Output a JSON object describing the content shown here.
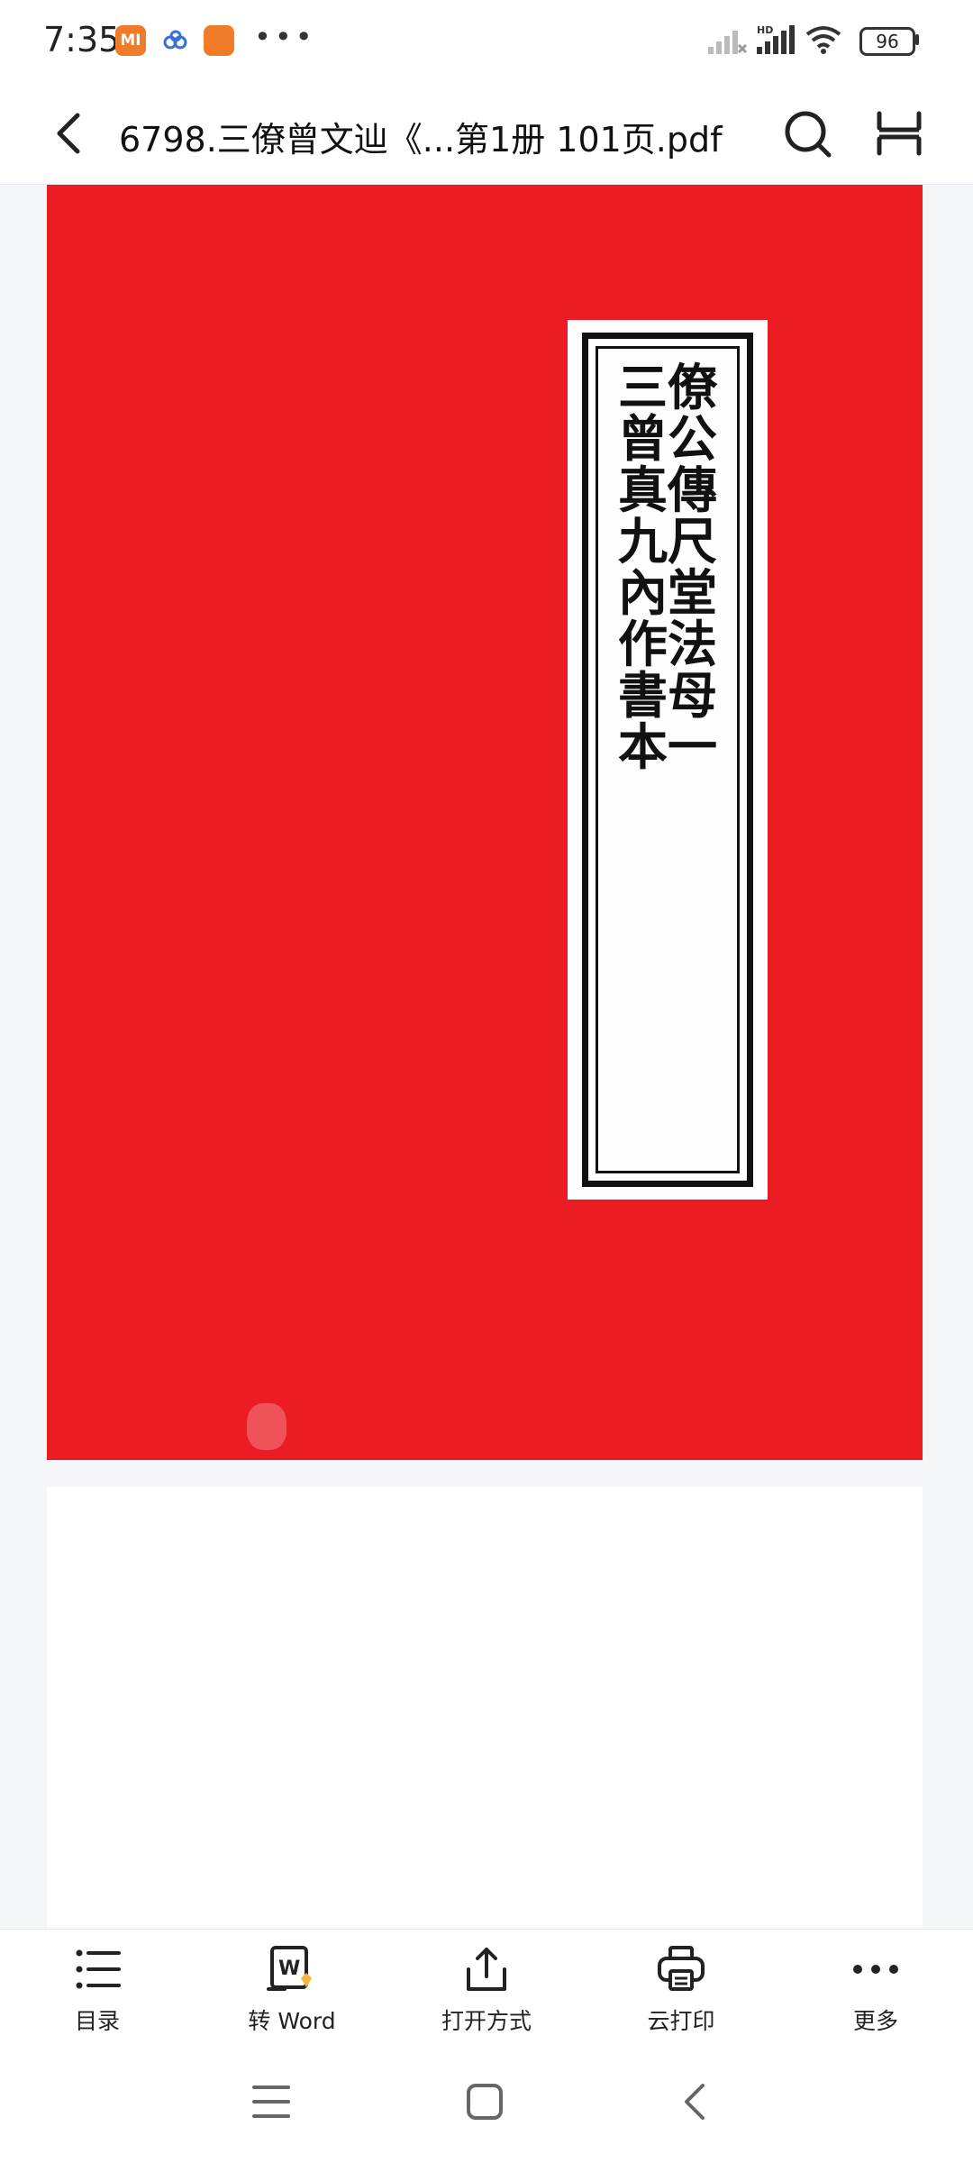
{
  "status_bar": {
    "time": "7:35",
    "mi_label": "MI",
    "battery": "96",
    "icons": [
      "mi-app-icon",
      "cloud-app-icon",
      "shopping-app-icon",
      "more-notifications-icon",
      "signal-icon",
      "hd-signal-icon",
      "wifi-icon",
      "battery-icon"
    ]
  },
  "header": {
    "title": "6798.三僚曾文辿《...第1册 101页.pdf",
    "icons": [
      "back-arrow-icon",
      "search-icon",
      "layout-icon"
    ]
  },
  "document": {
    "cover_title": "三僚曾公真傳九尺內堂作法書母本一",
    "cover_color": "#ec1c24"
  },
  "toolbar": {
    "items": [
      {
        "label": "目录",
        "icon": "list-icon"
      },
      {
        "label": "转 Word",
        "icon": "convert-word-icon"
      },
      {
        "label": "打开方式",
        "icon": "share-icon"
      },
      {
        "label": "云打印",
        "icon": "printer-icon"
      },
      {
        "label": "更多",
        "icon": "more-icon"
      }
    ]
  },
  "nav_bar": {
    "icons": [
      "nav-menu-icon",
      "nav-home-icon",
      "nav-back-icon"
    ]
  }
}
